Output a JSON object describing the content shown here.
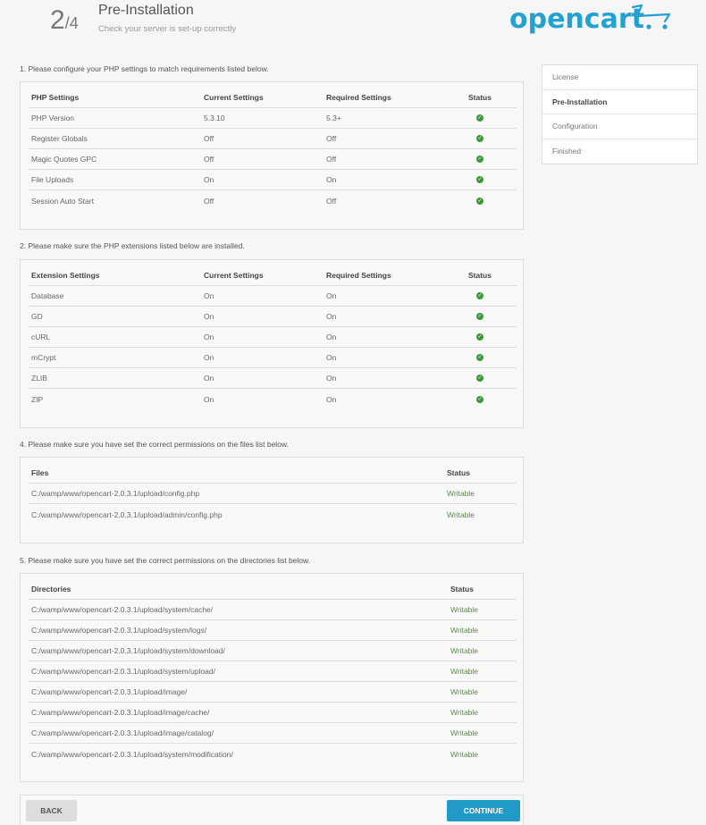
{
  "header": {
    "step_current": "2",
    "step_total": "/4",
    "title": "Pre-Installation",
    "subtitle": "Check your server is set-up correctly",
    "logo_text": "opencart",
    "brand_color": "#23a1d1"
  },
  "sidebar": {
    "items": [
      {
        "label": "License",
        "active": false
      },
      {
        "label": "Pre-Installation",
        "active": true
      },
      {
        "label": "Configuration",
        "active": false
      },
      {
        "label": "Finished",
        "active": false
      }
    ]
  },
  "php": {
    "label": "1. Please configure your PHP settings to match requirements listed below.",
    "headers": [
      "PHP Settings",
      "Current Settings",
      "Required Settings",
      "Status"
    ],
    "rows": [
      [
        "PHP Version",
        "5.3.10",
        "5.3+"
      ],
      [
        "Register Globals",
        "Off",
        "Off"
      ],
      [
        "Magic Quotes GPC",
        "Off",
        "Off"
      ],
      [
        "File Uploads",
        "On",
        "On"
      ],
      [
        "Session Auto Start",
        "Off",
        "Off"
      ]
    ]
  },
  "ext": {
    "label": "2. Please make sure the PHP extensions listed below are installed.",
    "headers": [
      "Extension Settings",
      "Current Settings",
      "Required Settings",
      "Status"
    ],
    "rows": [
      [
        "Database",
        "On",
        "On"
      ],
      [
        "GD",
        "On",
        "On"
      ],
      [
        "cURL",
        "On",
        "On"
      ],
      [
        "mCrypt",
        "On",
        "On"
      ],
      [
        "ZLIB",
        "On",
        "On"
      ],
      [
        "ZIP",
        "On",
        "On"
      ]
    ]
  },
  "files": {
    "label": "4. Please make sure you have set the correct permissions on the files list below.",
    "headers": [
      "Files",
      "Status"
    ],
    "rows": [
      [
        "C:/wamp/www/opencart-2.0.3.1/upload/config.php",
        "Writable"
      ],
      [
        "C:/wamp/www/opencart-2.0.3.1/upload/admin/config.php",
        "Writable"
      ]
    ]
  },
  "dirs": {
    "label": "5. Please make sure you have set the correct permissions on the directories list below.",
    "headers": [
      "Directories",
      "Status"
    ],
    "rows": [
      [
        "C:/wamp/www/opencart-2.0.3.1/upload/system/cache/",
        "Writable"
      ],
      [
        "C:/wamp/www/opencart-2.0.3.1/upload/system/logs/",
        "Writable"
      ],
      [
        "C:/wamp/www/opencart-2.0.3.1/upload/system/download/",
        "Writable"
      ],
      [
        "C:/wamp/www/opencart-2.0.3.1/upload/system/upload/",
        "Writable"
      ],
      [
        "C:/wamp/www/opencart-2.0.3.1/upload/image/",
        "Writable"
      ],
      [
        "C:/wamp/www/opencart-2.0.3.1/upload/image/cache/",
        "Writable"
      ],
      [
        "C:/wamp/www/opencart-2.0.3.1/upload/image/catalog/",
        "Writable"
      ],
      [
        "C:/wamp/www/opencart-2.0.3.1/upload/system/modification/",
        "Writable"
      ]
    ]
  },
  "footer": {
    "back_label": "BACK",
    "continue_label": "CONTINUE"
  }
}
